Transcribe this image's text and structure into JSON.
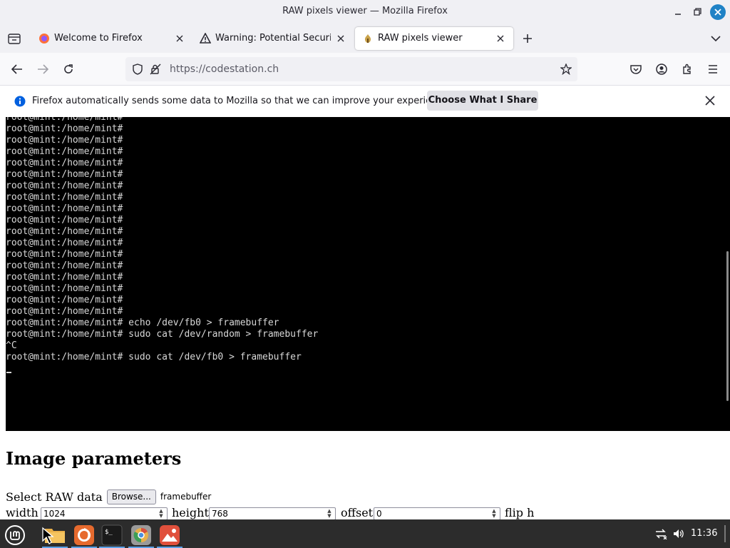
{
  "window": {
    "title": "RAW pixels viewer — Mozilla Firefox"
  },
  "tabs": [
    {
      "label": "Welcome to Firefox",
      "icon": "firefox-icon"
    },
    {
      "label": "Warning: Potential Security",
      "icon": "warning-icon"
    },
    {
      "label": "RAW pixels viewer",
      "icon": "page-favicon-icon"
    }
  ],
  "navbar": {
    "url": "https://codestation.ch"
  },
  "notification": {
    "text": "Firefox automatically sends some data to Mozilla so that we can improve your experience.",
    "button": "Choose What I Share"
  },
  "terminal": {
    "lines": [
      "root@mint:/home/mint#",
      "root@mint:/home/mint#",
      "root@mint:/home/mint#",
      "root@mint:/home/mint#",
      "root@mint:/home/mint#",
      "root@mint:/home/mint#",
      "root@mint:/home/mint#",
      "root@mint:/home/mint#",
      "root@mint:/home/mint#",
      "root@mint:/home/mint#",
      "root@mint:/home/mint#",
      "root@mint:/home/mint#",
      "root@mint:/home/mint#",
      "root@mint:/home/mint#",
      "root@mint:/home/mint#",
      "root@mint:/home/mint#",
      "root@mint:/home/mint#",
      "root@mint:/home/mint#",
      "root@mint:/home/mint# echo /dev/fb0 > framebuffer",
      "root@mint:/home/mint# sudo cat /dev/random > framebuffer",
      "^C",
      "root@mint:/home/mint# sudo cat /dev/fb0 > framebuffer"
    ]
  },
  "page": {
    "heading": "Image parameters",
    "select_label": "Select RAW data",
    "browse_label": "Browse...",
    "file_name": "framebuffer",
    "width_label": "width",
    "width_value": "1024",
    "height_label": "height",
    "height_value": "768",
    "offset_label": "offset",
    "offset_value": "0",
    "flip_label": "flip h"
  },
  "taskbar": {
    "apps": [
      "menu-icon",
      "files-icon",
      "firefox-icon",
      "terminal-icon",
      "chromium-icon",
      "image-viewer-icon"
    ],
    "clock": "11:36"
  },
  "colors": {
    "accent": "#0060df",
    "taskbar": "#2c2c2c",
    "close": "#1f82c6"
  }
}
